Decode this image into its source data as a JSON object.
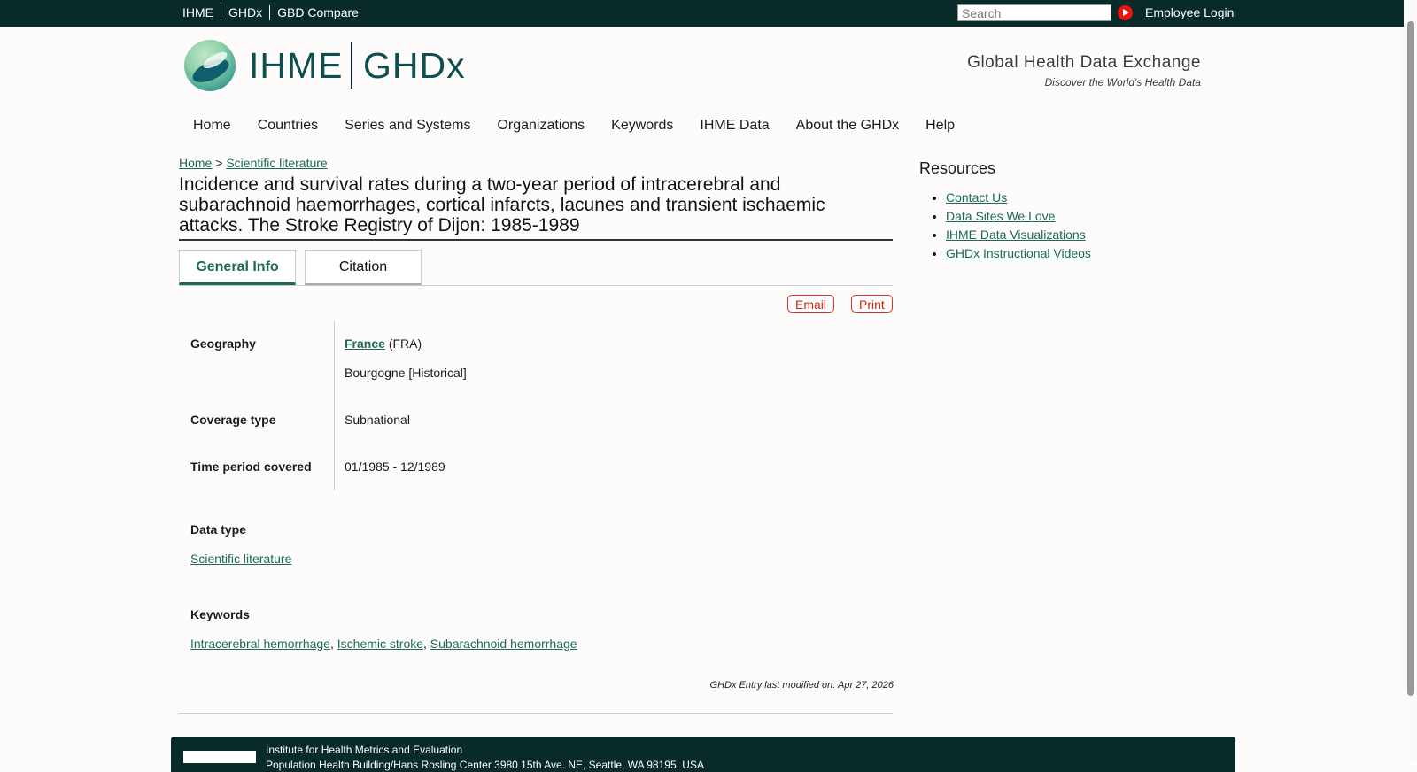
{
  "topbar": {
    "links": [
      "IHME",
      "GHDx",
      "GBD Compare"
    ],
    "search_placeholder": "Search",
    "employee_login": "Employee Login"
  },
  "header": {
    "logo_left": "IHME",
    "logo_right": "GHDx",
    "tagline": "Global Health Data Exchange",
    "subtagline": "Discover the World's Health Data"
  },
  "nav": [
    "Home",
    "Countries",
    "Series and Systems",
    "Organizations",
    "Keywords",
    "IHME Data",
    "About the GHDx",
    "Help"
  ],
  "breadcrumb": {
    "home": "Home",
    "sep": ">",
    "current": "Scientific literature"
  },
  "title": "Incidence and survival rates during a two-year period of intracerebral and subarachnoid haemorrhages, cortical infarcts, lacunes and transient ischaemic attacks. The Stroke Registry of Dijon: 1985-1989",
  "tabs": {
    "general": "General Info",
    "citation": "Citation"
  },
  "actions": {
    "email": "Email",
    "print": "Print"
  },
  "fields": {
    "geography_label": "Geography",
    "geography_country": "France",
    "geography_code": "(FRA)",
    "geography_region": "Bourgogne [Historical]",
    "coverage_label": "Coverage type",
    "coverage_value": "Subnational",
    "time_label": "Time period covered",
    "time_value": "01/1985 - 12/1989",
    "datatype_label": "Data type",
    "datatype_value": "Scientific literature",
    "keywords_label": "Keywords",
    "keywords": [
      "Intracerebral hemorrhage",
      "Ischemic stroke",
      "Subarachnoid hemorrhage"
    ],
    "keyword_sep": ","
  },
  "modified": "GHDx Entry last modified on: Apr 27, 2026",
  "sidebar": {
    "title": "Resources",
    "links": [
      "Contact Us",
      "Data Sites We Love",
      "IHME Data Visualizations",
      "GHDx Instructional Videos"
    ]
  },
  "footer": {
    "org": "Institute for Health Metrics and Evaluation",
    "address": "Population Health Building/Hans Rosling Center 3980 15th Ave. NE, Seattle, WA 98195, USA"
  },
  "icons": {
    "search_go": "play-circle-icon"
  },
  "colors": {
    "topbar": "#082b2a",
    "link": "#1c6b4e",
    "accent_red": "#e11111"
  }
}
